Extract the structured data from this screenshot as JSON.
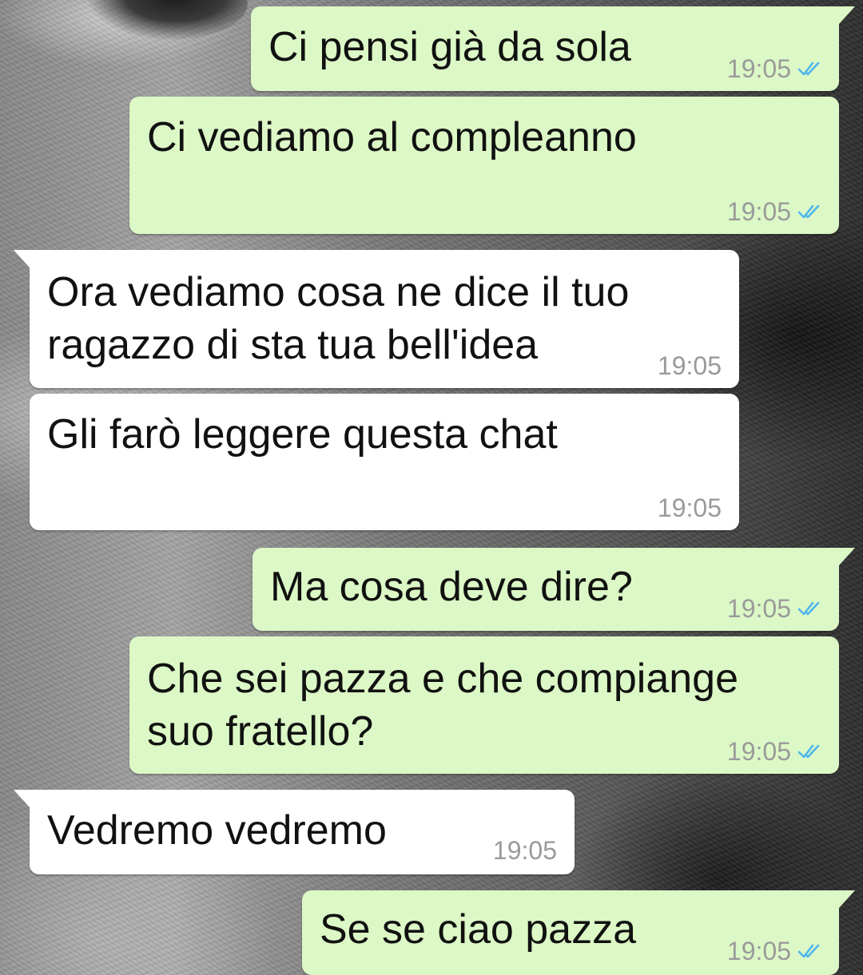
{
  "chat": {
    "messages": [
      {
        "direction": "sent",
        "text": "Ci pensi già da sola",
        "time": "19:05",
        "status_icon": "double-check-read-icon"
      },
      {
        "direction": "sent",
        "text": "Ci vediamo al compleanno",
        "time": "19:05",
        "status_icon": "double-check-read-icon"
      },
      {
        "direction": "received",
        "text": "Ora vediamo cosa ne dice il tuo\nragazzo di sta tua bell'idea",
        "time": "19:05"
      },
      {
        "direction": "received",
        "text": "Gli farò leggere questa chat",
        "time": "19:05"
      },
      {
        "direction": "sent",
        "text": "Ma cosa deve dire?",
        "time": "19:05",
        "status_icon": "double-check-read-icon"
      },
      {
        "direction": "sent",
        "text": "Che sei pazza e che compiange\nsuo fratello?",
        "time": "19:05",
        "status_icon": "double-check-read-icon"
      },
      {
        "direction": "received",
        "text": "Vedremo vedremo",
        "time": "19:05"
      },
      {
        "direction": "sent",
        "text": "Se se ciao pazza",
        "time": "19:05",
        "status_icon": "double-check-read-icon"
      }
    ]
  },
  "colors": {
    "sent_bubble": "#dcf8c6",
    "received_bubble": "#ffffff",
    "read_tick": "#4fb6ec",
    "timestamp": "#9a9a9a"
  },
  "wallpaper": "grayscale-photo"
}
